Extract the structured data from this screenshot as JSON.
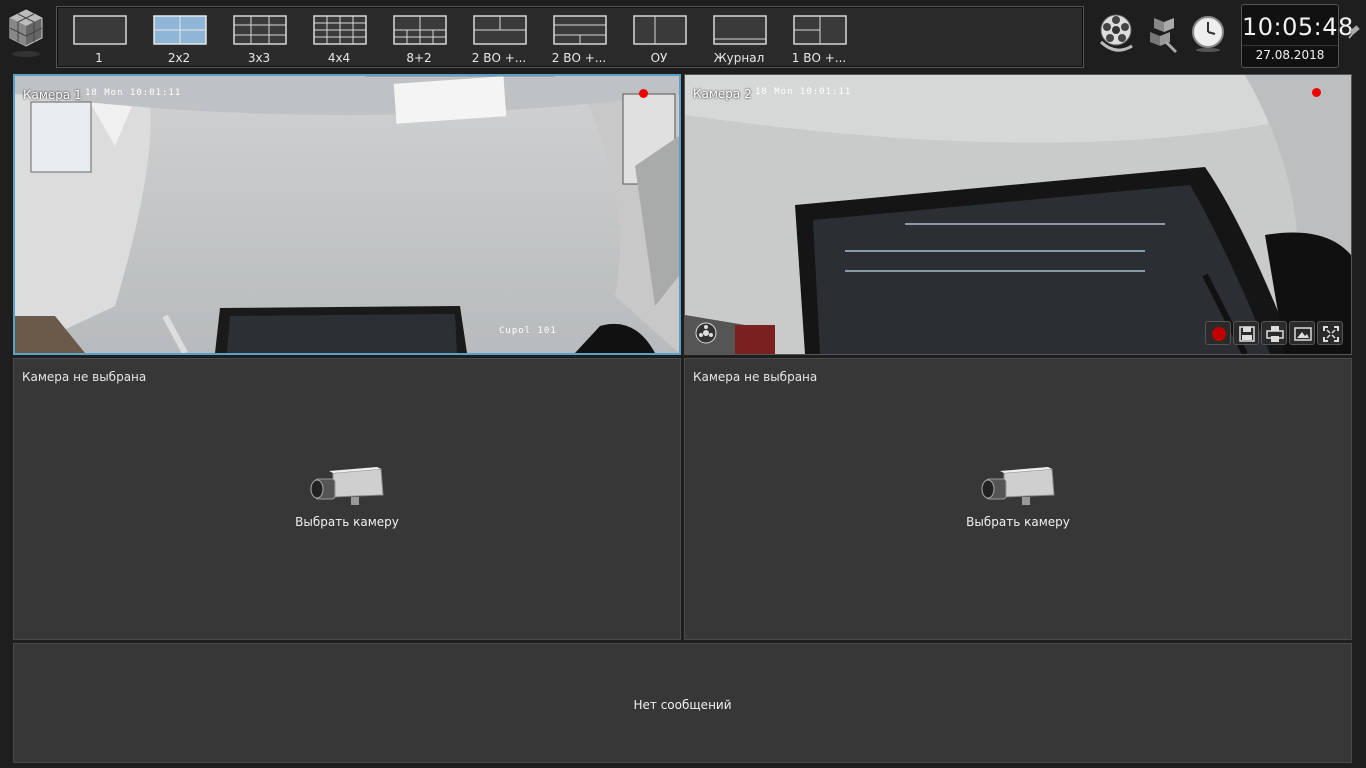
{
  "layouts": [
    {
      "label": "1",
      "icon": "layout-1-icon"
    },
    {
      "label": "2x2",
      "icon": "layout-2x2-icon",
      "selected": true
    },
    {
      "label": "3x3",
      "icon": "layout-3x3-icon"
    },
    {
      "label": "4x4",
      "icon": "layout-4x4-icon"
    },
    {
      "label": "8+2",
      "icon": "layout-8plus2-icon"
    },
    {
      "label": "2 ВО +...",
      "icon": "layout-2vo-icon"
    },
    {
      "label": "2 ВО +...",
      "icon": "layout-2vo-alt-icon"
    },
    {
      "label": "ОУ",
      "icon": "layout-ou-icon"
    },
    {
      "label": "Журнал",
      "icon": "journal-icon"
    },
    {
      "label": "1 ВО +...",
      "icon": "layout-1vo-icon"
    }
  ],
  "clock": {
    "time": "10:05:48",
    "date": "27.08.2018"
  },
  "cameras": [
    {
      "title": "Камера 1",
      "osd": "18 Mon 10:01:11",
      "osd_name": "Cupol 101"
    },
    {
      "title": "Камера 2",
      "osd": "18 Mon 10:01:11"
    }
  ],
  "empty_cells": [
    {
      "title": "Камера не выбрана",
      "action": "Выбрать камеру"
    },
    {
      "title": "Камера не выбрана",
      "action": "Выбрать камеру"
    }
  ],
  "messages": {
    "text": "Нет сообщений"
  },
  "colors": {
    "accent": "#5aa0c8",
    "record": "#e00000",
    "background": "#373737"
  }
}
